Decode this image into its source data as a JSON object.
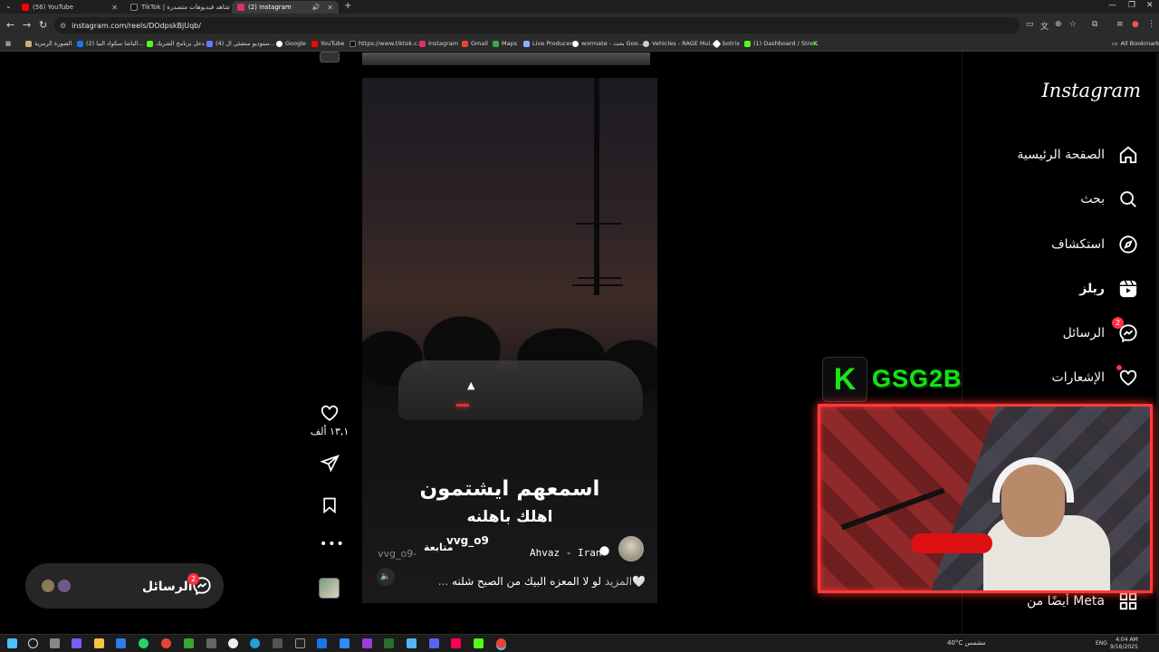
{
  "browser": {
    "tabs": [
      {
        "title": "(56) YouTube",
        "color": "#ff0000"
      },
      {
        "title": "TikTok | شاهد فيديوهات متصدرة",
        "color": "#111111"
      },
      {
        "title": "(2) Instagram",
        "color": "#e1306c"
      }
    ],
    "url": "instagram.com/reels/DOdpskBjUqb/",
    "bookmarks": [
      {
        "label": "الصورة الرمزية",
        "color": "#c9b07a"
      },
      {
        "label": "(2) الباشا سكواد البيا...",
        "color": "#1877f2"
      },
      {
        "label": "دخل برنامج الشريك...",
        "color": "#53fc18"
      },
      {
        "label": "(4) ستوديو منشئي ال...",
        "color": "#5b7fff"
      },
      {
        "label": "Google",
        "color": "#ffffff"
      },
      {
        "label": "YouTube",
        "color": "#ff0000"
      },
      {
        "label": "https://www.tiktok.c...",
        "color": "#111111"
      },
      {
        "label": "Instagram",
        "color": "#e1306c"
      },
      {
        "label": "Gmail",
        "color": "#ea4335"
      },
      {
        "label": "Maps",
        "color": "#34a853"
      },
      {
        "label": "Live Producer",
        "color": "#8ab4f8"
      },
      {
        "label": "wormate - بحث Goo...",
        "color": "#ffffff"
      },
      {
        "label": "Vehicles - RAGE Mul...",
        "color": "#cccccc"
      },
      {
        "label": "botrix",
        "color": "#ffffff"
      },
      {
        "label": "(1) Dashboard / Stre...",
        "color": "#53fc18"
      }
    ],
    "all_bookmarks": "All Bookmarks"
  },
  "sidebar": {
    "logo": "Instagram",
    "items": [
      {
        "label": "الصفحة الرئيسية",
        "icon": "home-icon"
      },
      {
        "label": "بحث",
        "icon": "search-icon"
      },
      {
        "label": "استكشاف",
        "icon": "compass-icon"
      },
      {
        "label": "ريلز",
        "icon": "reels-icon"
      },
      {
        "label": "الرسائل",
        "icon": "messenger-icon",
        "badge": "2"
      },
      {
        "label": "الإشعارات",
        "icon": "heart-icon"
      }
    ],
    "meta": "أيضًا من Meta"
  },
  "reel": {
    "overlay_title": "اسمعهم ايشتمون",
    "overlay_sub": "اهلك باهلنه",
    "username": "vvg_o9",
    "username_ghost": "vvg_o9-",
    "follow": "متابعة",
    "location": "Ahvaz - Iran",
    "caption": "لو لا المعزه البيك من الصبح شلنه🤍",
    "caption_more": "... المزيد",
    "likes": "١٣,١ ألف"
  },
  "messages_pill": {
    "label": "الرسائل",
    "badge": "2"
  },
  "stream_overlay": {
    "logo_letter": "K",
    "channel": "GSG2B",
    "accent": "#19e619",
    "frame_color": "#ff3b3b"
  },
  "taskbar": {
    "weather": "40°C مشمس",
    "lang": "ENG",
    "time": "4:04 AM",
    "date": "9/16/2025"
  }
}
